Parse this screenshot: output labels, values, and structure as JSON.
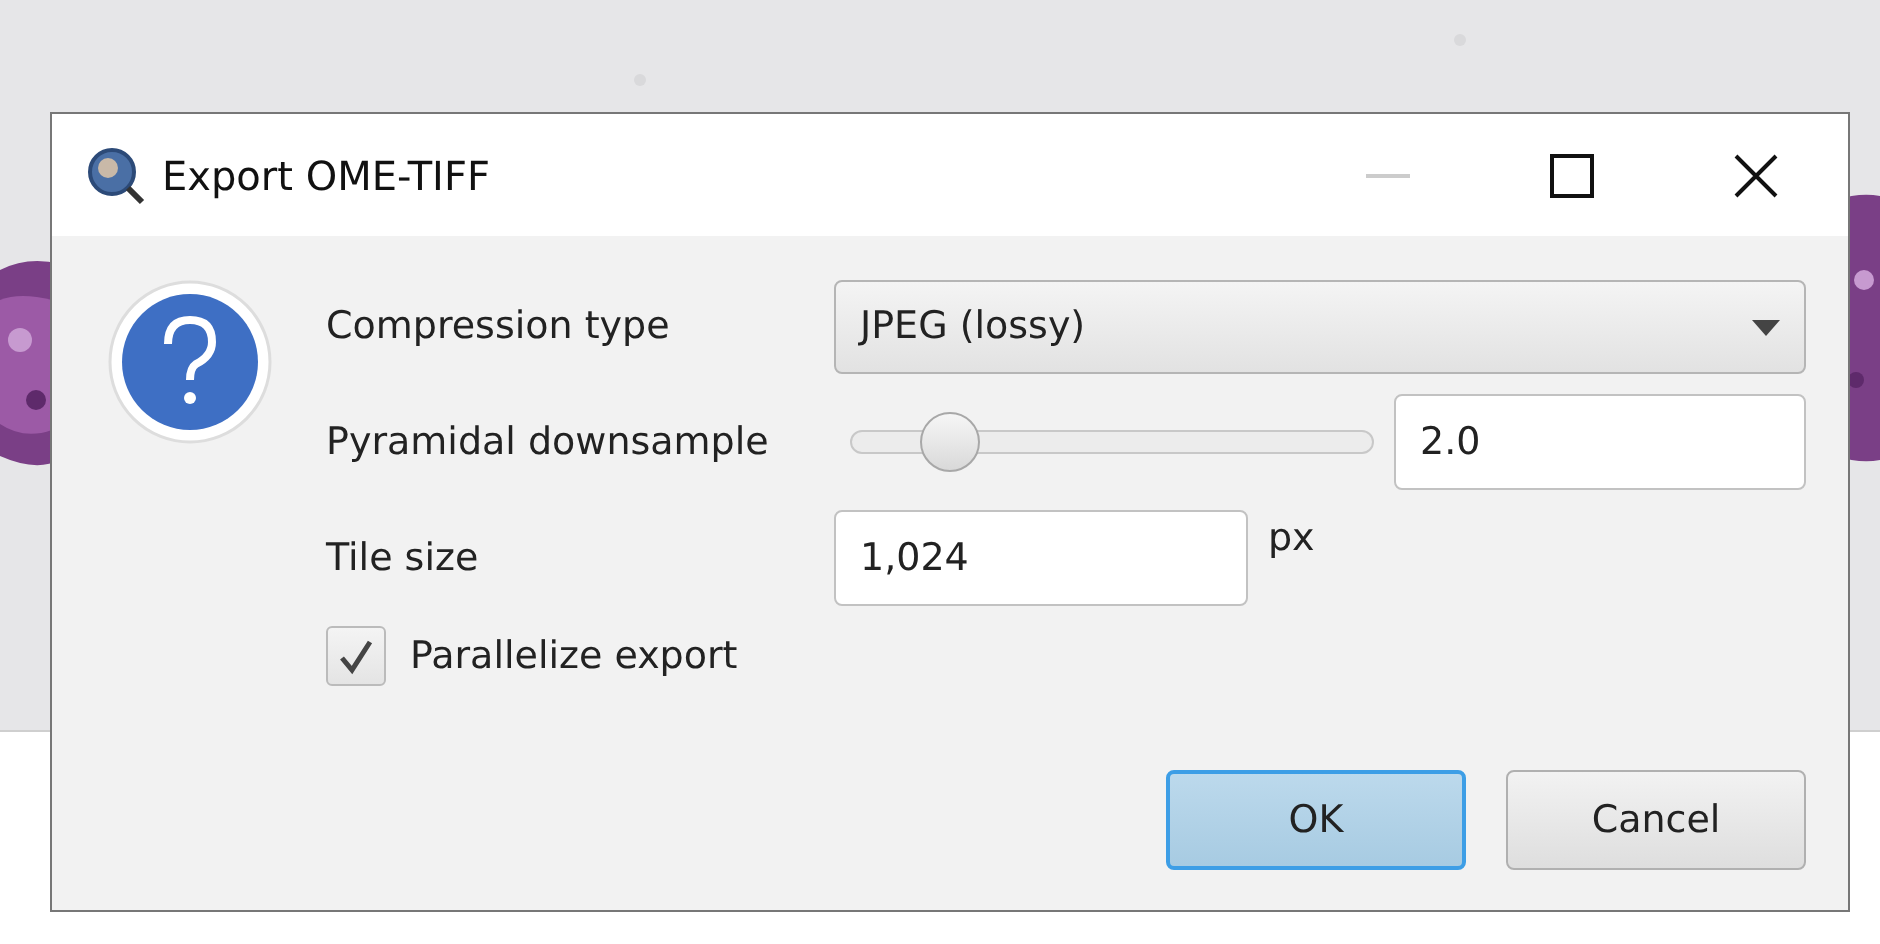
{
  "dialog": {
    "title": "Export OME-TIFF",
    "fields": [
      {
        "kind": "select",
        "label": "Compression type",
        "value": "JPEG (lossy)"
      },
      {
        "kind": "slider",
        "label": "Pyramidal downsample",
        "level": 0.15,
        "value": "2.0"
      },
      {
        "kind": "number",
        "label": "Tile size",
        "value": "1,024",
        "unit": "px"
      },
      {
        "kind": "checkbox",
        "label": "Parallelize export",
        "checked": true
      }
    ],
    "buttons": [
      {
        "label": "OK",
        "default": true
      },
      {
        "label": "Cancel",
        "default": false
      }
    ]
  }
}
